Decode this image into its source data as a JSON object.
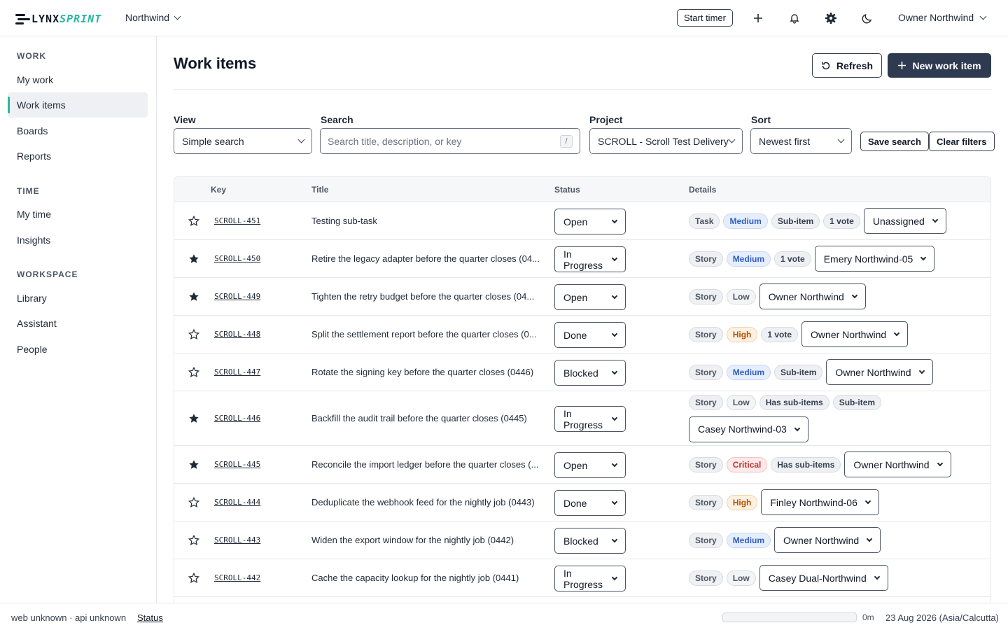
{
  "app": {
    "logo_main": "LYNX",
    "logo_accent": "SPRINT",
    "workspace": "Northwind",
    "start_timer": "Start timer",
    "user": "Owner Northwind"
  },
  "sidebar": {
    "sections": [
      {
        "label": "WORK",
        "items": [
          "My work",
          "Work items",
          "Boards",
          "Reports"
        ]
      },
      {
        "label": "TIME",
        "items": [
          "My time",
          "Insights"
        ]
      },
      {
        "label": "WORKSPACE",
        "items": [
          "Library",
          "Assistant",
          "People"
        ]
      }
    ],
    "active": "Work items"
  },
  "page": {
    "title": "Work items",
    "refresh": "Refresh",
    "new_item": "New work item"
  },
  "filters": {
    "view_label": "View",
    "view_value": "Simple search",
    "search_label": "Search",
    "search_placeholder": "Search title, description, or key",
    "search_shortcut": "/",
    "project_label": "Project",
    "project_value": "SCROLL - Scroll Test Delivery",
    "sort_label": "Sort",
    "sort_value": "Newest first",
    "save_search": "Save search",
    "clear_filters": "Clear filters"
  },
  "table": {
    "headers": [
      "Key",
      "Title",
      "Status",
      "Details"
    ],
    "rows": [
      {
        "starred": false,
        "key": "SCROLL-451",
        "title": "Testing sub-task",
        "status": "Open",
        "pills": [
          {
            "t": "Task",
            "k": "story"
          },
          {
            "t": "Medium",
            "k": "medium"
          },
          {
            "t": "Sub-item",
            "k": ""
          },
          {
            "t": "1 vote",
            "k": ""
          }
        ],
        "assignee": "Unassigned"
      },
      {
        "starred": true,
        "key": "SCROLL-450",
        "title": "Retire the legacy adapter before the quarter closes (04...",
        "status": "In Progress",
        "pills": [
          {
            "t": "Story",
            "k": "story"
          },
          {
            "t": "Medium",
            "k": "medium"
          },
          {
            "t": "1 vote",
            "k": ""
          }
        ],
        "assignee": "Emery Northwind-05"
      },
      {
        "starred": true,
        "key": "SCROLL-449",
        "title": "Tighten the retry budget before the quarter closes (04...",
        "status": "Open",
        "pills": [
          {
            "t": "Story",
            "k": "story"
          },
          {
            "t": "Low",
            "k": "low"
          }
        ],
        "assignee": "Owner Northwind"
      },
      {
        "starred": false,
        "key": "SCROLL-448",
        "title": "Split the settlement report before the quarter closes (0...",
        "status": "Done",
        "pills": [
          {
            "t": "Story",
            "k": "story"
          },
          {
            "t": "High",
            "k": "high"
          },
          {
            "t": "1 vote",
            "k": ""
          }
        ],
        "assignee": "Owner Northwind"
      },
      {
        "starred": false,
        "key": "SCROLL-447",
        "title": "Rotate the signing key before the quarter closes (0446)",
        "status": "Blocked",
        "pills": [
          {
            "t": "Story",
            "k": "story"
          },
          {
            "t": "Medium",
            "k": "medium"
          },
          {
            "t": "Sub-item",
            "k": ""
          }
        ],
        "assignee": "Owner Northwind"
      },
      {
        "starred": true,
        "key": "SCROLL-446",
        "title": "Backfill the audit trail before the quarter closes (0445)",
        "status": "In Progress",
        "pills": [
          {
            "t": "Story",
            "k": "story"
          },
          {
            "t": "Low",
            "k": "low"
          },
          {
            "t": "Has sub-items",
            "k": ""
          },
          {
            "t": "Sub-item",
            "k": ""
          }
        ],
        "assignee": "Casey Northwind-03"
      },
      {
        "starred": true,
        "key": "SCROLL-445",
        "title": "Reconcile the import ledger before the quarter closes (...",
        "status": "Open",
        "pills": [
          {
            "t": "Story",
            "k": "story"
          },
          {
            "t": "Critical",
            "k": "critical"
          },
          {
            "t": "Has sub-items",
            "k": ""
          }
        ],
        "assignee": "Owner Northwind"
      },
      {
        "starred": false,
        "key": "SCROLL-444",
        "title": "Deduplicate the webhook feed for the nightly job (0443)",
        "status": "Done",
        "pills": [
          {
            "t": "Story",
            "k": "story"
          },
          {
            "t": "High",
            "k": "high"
          }
        ],
        "assignee": "Finley Northwind-06"
      },
      {
        "starred": false,
        "key": "SCROLL-443",
        "title": "Widen the export window for the nightly job (0442)",
        "status": "Blocked",
        "pills": [
          {
            "t": "Story",
            "k": "story"
          },
          {
            "t": "Medium",
            "k": "medium"
          }
        ],
        "assignee": "Owner Northwind"
      },
      {
        "starred": false,
        "key": "SCROLL-442",
        "title": "Cache the capacity lookup for the nightly job (0441)",
        "status": "In Progress",
        "pills": [
          {
            "t": "Story",
            "k": "story"
          },
          {
            "t": "Low",
            "k": "low"
          }
        ],
        "assignee": "Casey Dual-Northwind"
      }
    ]
  },
  "footer": {
    "env": "web unknown · api unknown",
    "status_link": "Status",
    "timer": "0m",
    "date": "23 Aug 2026 (Asia/Calcutta)"
  },
  "icons": [
    "chevron-down-icon",
    "plus-icon",
    "bell-icon",
    "gear-icon",
    "moon-icon",
    "refresh-icon",
    "star-icon"
  ],
  "colors": {
    "accent": "#2bb6a0",
    "primary_button": "#2d3a50",
    "medium": "#2f5ec5",
    "high": "#b45309",
    "critical": "#c53030"
  }
}
